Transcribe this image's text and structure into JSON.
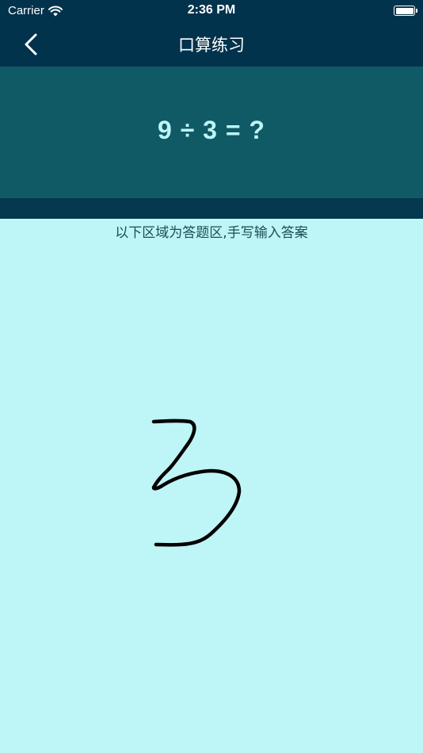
{
  "status_bar": {
    "carrier": "Carrier",
    "time": "2:36 PM",
    "icons": [
      "wifi-icon",
      "battery-icon"
    ]
  },
  "nav": {
    "title": "口算练习",
    "back_icon": "chevron-left-icon"
  },
  "question": {
    "text": "9 ÷ 3 = ?"
  },
  "answer_area": {
    "instruction": "以下区域为答题区,手写输入答案"
  },
  "colors": {
    "nav_background": "#02334c",
    "question_panel": "#105a66",
    "answer_background": "#bef5f6",
    "question_text": "#bef5f6",
    "ink": "#000000"
  }
}
